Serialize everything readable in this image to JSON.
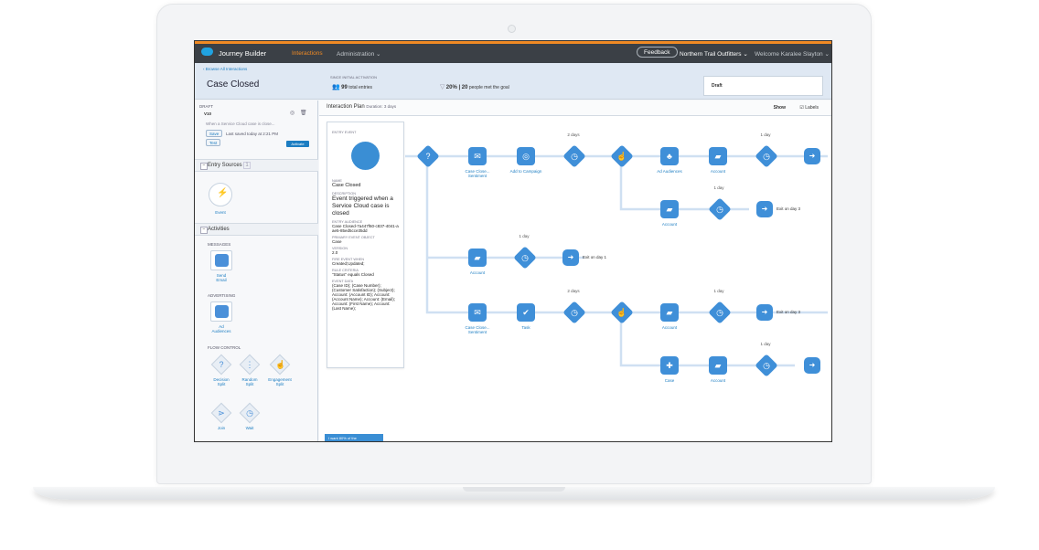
{
  "topbar": {
    "app_name": "Journey Builder",
    "nav_interactions": "Interactions",
    "nav_administration": "Administration ⌄",
    "feedback": "Feedback",
    "org": "Northern Trail Outfitters ⌄",
    "welcome": "Welcome Karalee Slayton ⌄"
  },
  "subhead": {
    "browse": "‹ Browse All Interactions",
    "title": "Case Closed",
    "since": "SINCE INITIAL ACTIVATION",
    "entries_value": "99",
    "entries_label": "total entries",
    "goal_value": "20% | 20",
    "goal_label": "people met the goal",
    "status": "Draft"
  },
  "sidebar": {
    "draft": "DRAFT",
    "version": "V10",
    "description": "When a Service Cloud case is close...",
    "save": "Save",
    "last_saved": "Last saved today at 2:21 PM",
    "test": "Test",
    "activate": "Activate",
    "entry_sources": "Entry Sources",
    "entry_count": "1",
    "event": "Event",
    "activities": "Activities",
    "messages": "MESSAGES",
    "send_email": "Send\nEmail",
    "advertising": "ADVERTISING",
    "ad_audiences": "Ad\nAudiences",
    "flow_control": "FLOW CONTROL",
    "decision_split": "Decision\nSplit",
    "random_split": "Random\nSplit",
    "engagement_split": "Engagement\nSplit",
    "join": "Join",
    "wait": "Wait"
  },
  "canvas": {
    "plan_title": "Interaction Plan",
    "duration": "Duration: 3 days",
    "show": "Show",
    "labels": "Labels",
    "bottom_note": "I want 80% of the"
  },
  "entry_panel": {
    "entry_event": "ENTRY EVENT",
    "name_key": "NAME",
    "name_val": "Case Closed",
    "desc_key": "DESCRIPTION",
    "desc_val": "Event triggered when a Service Cloud case is closed",
    "aud_key": "ENTRY AUDIENCE",
    "aud_val": "Case Closed-7a447f60-c837-4041-aae5-85ed5cce35dd",
    "obj_key": "PRIMARY EVENT OBJECT",
    "obj_val": "Case",
    "ver_key": "VERSION",
    "ver_val": "2.0",
    "fire_key": "FIRE EVENT WHEN",
    "fire_val": "Created;Updated;",
    "rule_key": "RULE CRITERIA",
    "rule_val": "\"Status\" equals Closed",
    "data_key": "EVENT DATA",
    "data_val": "(Case ID); (Case Number); (Customer Satisfaction); (Subject); Account: (Account ID); Account: (Account Name); Account: (Email); Account: (First Name); Account: (Last Name);"
  },
  "flow": {
    "case_close_sentiment": "Case Close... Sentiment",
    "add_to_campaign": "Add to Campaign",
    "ad_audiences": "Ad Audiences",
    "account": "Account",
    "task": "Task",
    "case": "Case",
    "days2": "2 days",
    "day1": "1 day",
    "exit_day3": "Exit on day 3",
    "exit_day1": "Exit on day 1"
  }
}
